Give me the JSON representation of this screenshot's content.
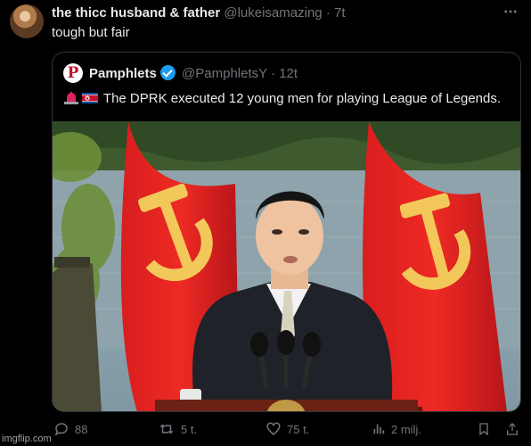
{
  "tweet": {
    "author_name": "the thicc husband & father",
    "author_handle": "@lukeisamazing",
    "dot": "·",
    "time": "7t",
    "more_icon": "more-icon",
    "text": "tough but fair"
  },
  "quote": {
    "avatar_letter": "P",
    "author_name": "Pamphlets",
    "author_handle": "@PamphletsY",
    "dot": "·",
    "time": "12t",
    "text": "The DPRK executed 12 young men for playing League of Legends."
  },
  "actions": {
    "replies": "88",
    "reposts": "5 t.",
    "likes": "75 t.",
    "views": "2 milj."
  },
  "watermark": "imgflip.com",
  "colors": {
    "background": "#000000",
    "verified": "#1d9bf0",
    "muted": "#71767b",
    "flag_red": "#c8102e"
  }
}
